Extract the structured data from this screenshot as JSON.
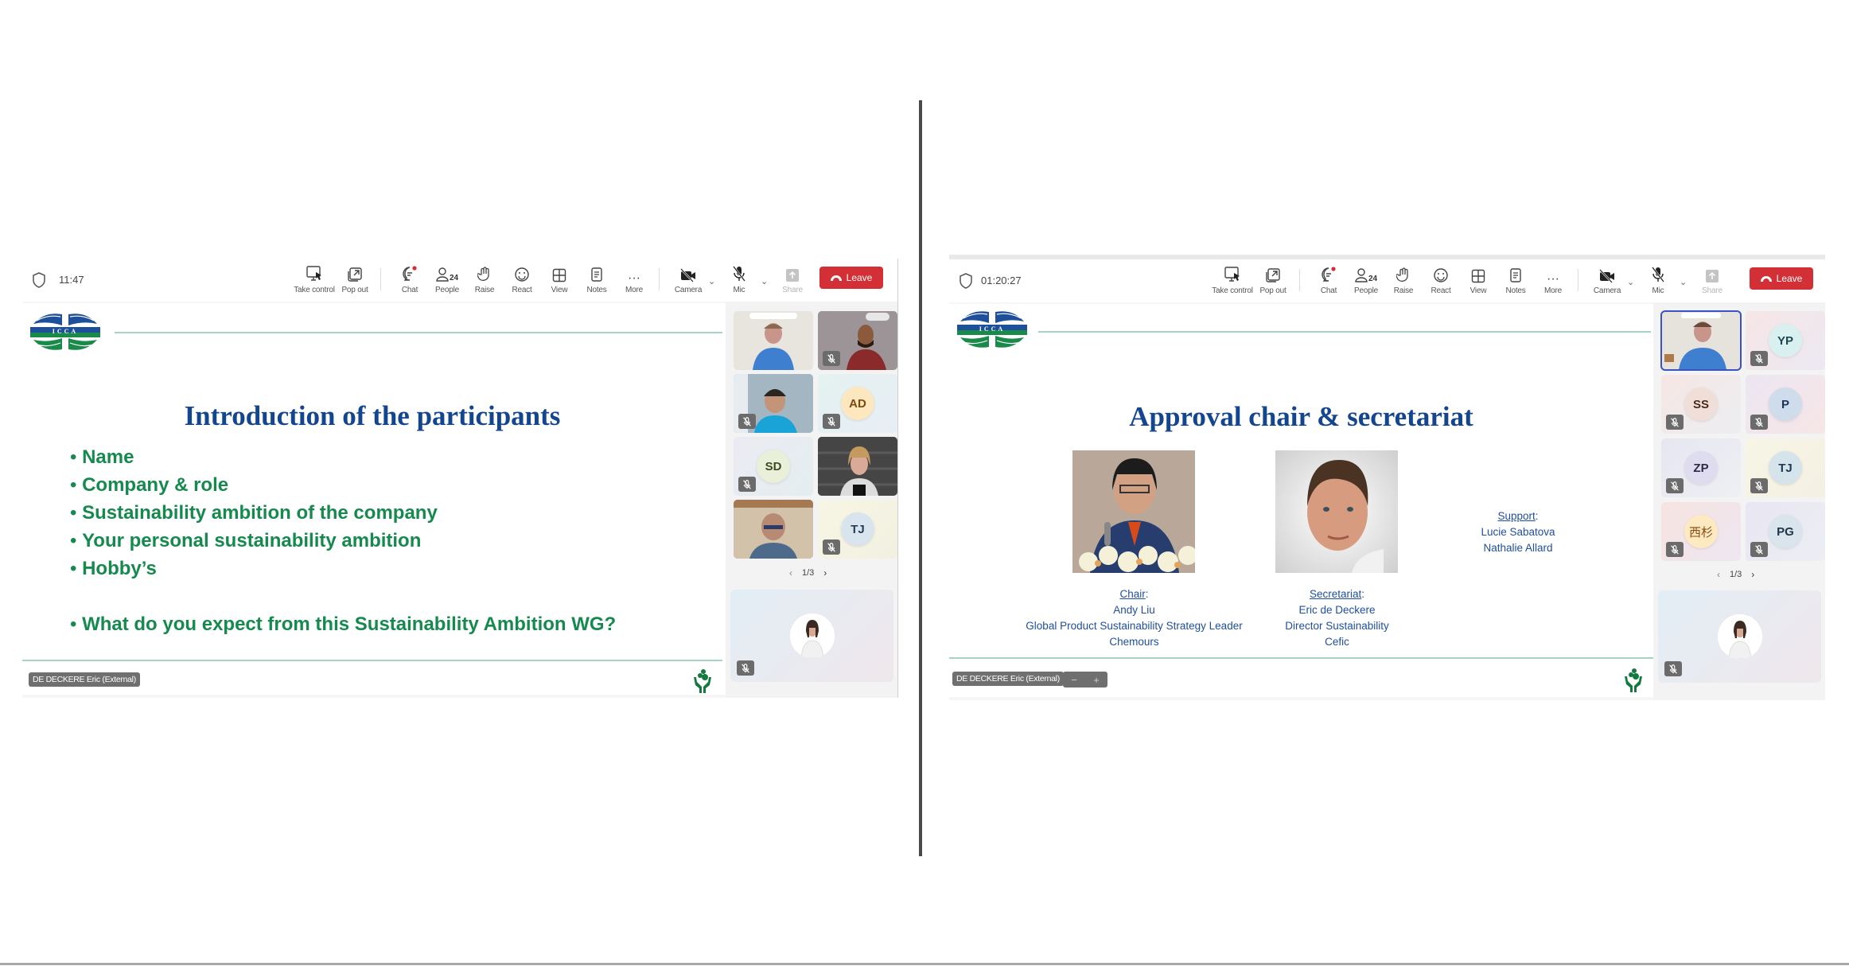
{
  "left_screen": {
    "toolbar": {
      "time": "11:47",
      "buttons": {
        "take_control": "Take control",
        "pop_out": "Pop out",
        "chat": "Chat",
        "people": "People",
        "people_count": "24",
        "raise": "Raise",
        "react": "React",
        "view": "View",
        "notes": "Notes",
        "more": "More",
        "camera": "Camera",
        "mic": "Mic",
        "share": "Share",
        "leave": "Leave"
      }
    },
    "slide": {
      "logo_text": "ICCA",
      "title": "Introduction of  the participants",
      "bullets": [
        "Name",
        "Company & role",
        "Sustainability ambition of the company",
        "Your personal sustainability ambition",
        "Hobby’s",
        "What do you expect from this Sustainability Ambition WG?"
      ]
    },
    "presenter_tag": "DE DECKERE Eric (External)",
    "participants": [
      {
        "initials": "",
        "type": "video",
        "muted": false
      },
      {
        "initials": "",
        "type": "video",
        "muted": true
      },
      {
        "initials": "",
        "type": "video",
        "muted": true
      },
      {
        "initials": "AD",
        "type": "avatar",
        "muted": true
      },
      {
        "initials": "SD",
        "type": "avatar",
        "muted": true
      },
      {
        "initials": "",
        "type": "video",
        "muted": false
      },
      {
        "initials": "",
        "type": "video",
        "muted": false
      },
      {
        "initials": "TJ",
        "type": "avatar",
        "muted": true
      }
    ],
    "pager": "1/3"
  },
  "right_screen": {
    "toolbar": {
      "time": "01:20:27",
      "buttons": {
        "take_control": "Take control",
        "pop_out": "Pop out",
        "chat": "Chat",
        "people": "People",
        "people_count": "24",
        "raise": "Raise",
        "react": "React",
        "view": "View",
        "notes": "Notes",
        "more": "More",
        "camera": "Camera",
        "mic": "Mic",
        "share": "Share",
        "leave": "Leave"
      }
    },
    "slide": {
      "logo_text": "ICCA",
      "title": "Approval chair & secretariat",
      "chair": {
        "label": "Chair",
        "name": "Andy Liu",
        "role": "Global Product Sustainability Strategy Leader",
        "org": "Chemours"
      },
      "secretariat": {
        "label": "Secretariat",
        "name": "Eric de Deckere",
        "role": "Director Sustainability",
        "org": "Cefic"
      },
      "support": {
        "label": "Support",
        "names": [
          "Lucie Sabatova",
          "Nathalie Allard"
        ]
      }
    },
    "presenter_tag": "DE DECKERE Eric (External)",
    "zoom_controls": {
      "minus": "−",
      "plus": "+"
    },
    "participants": [
      {
        "initials": "",
        "type": "video",
        "muted": false,
        "selected": true
      },
      {
        "initials": "YP",
        "type": "avatar",
        "muted": true
      },
      {
        "initials": "SS",
        "type": "avatar",
        "muted": true
      },
      {
        "initials": "P",
        "type": "avatar",
        "muted": true
      },
      {
        "initials": "ZP",
        "type": "avatar",
        "muted": true
      },
      {
        "initials": "TJ",
        "type": "avatar",
        "muted": true
      },
      {
        "initials": "西杉",
        "type": "avatar",
        "muted": true
      },
      {
        "initials": "PG",
        "type": "avatar",
        "muted": true
      }
    ],
    "pager": "1/3"
  },
  "colors": {
    "leave_red": "#d32f36",
    "slide_title_blue": "#14468f",
    "bullet_green": "#168a4e",
    "caption_blue": "#1f4e9c",
    "selected_outline": "#3c52c4"
  }
}
